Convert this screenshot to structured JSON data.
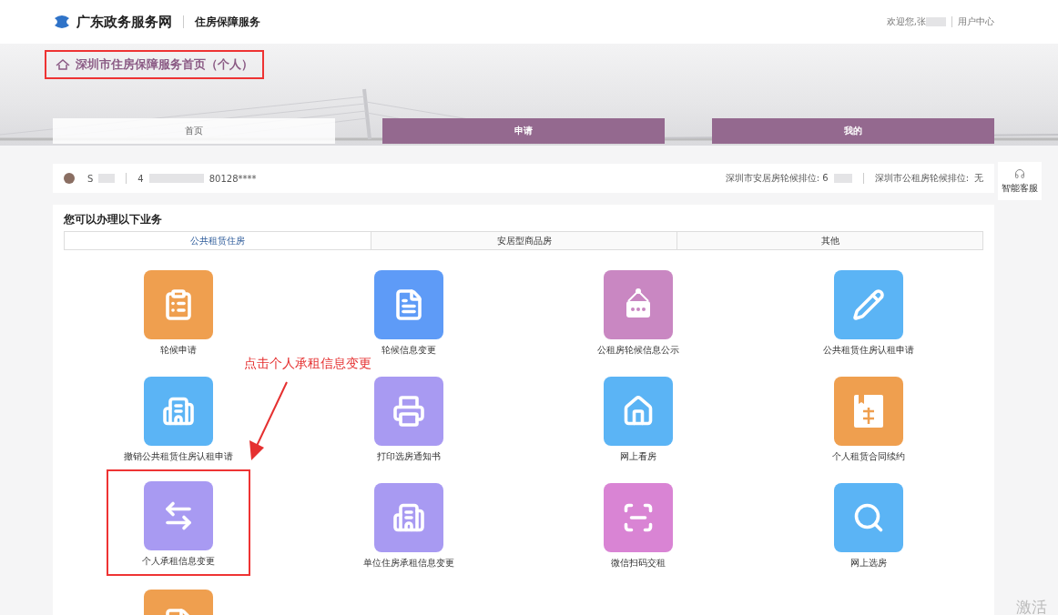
{
  "header": {
    "site_name": "广东政务服务网",
    "section": "住房保障服务",
    "welcome": "欢迎您,张",
    "user_center": "用户中心"
  },
  "banner": {
    "title": "深圳市住房保障服务首页（个人）",
    "highlighted": true
  },
  "nav_tabs": [
    {
      "label": "首页",
      "selected": true
    },
    {
      "label": "申请",
      "selected": false
    },
    {
      "label": "我的",
      "selected": false
    }
  ],
  "user_info": {
    "name": "S",
    "id_prefix": "4",
    "id_suffix": "80128****",
    "queue_1_label": "深圳市安居房轮候排位: 6",
    "queue_2_label": "深圳市公租房轮候排位: ",
    "queue_2_value": "无"
  },
  "assistant": {
    "label": "智能客服"
  },
  "services": {
    "title": "您可以办理以下业务",
    "tabs": [
      {
        "label": "公共租赁住房",
        "selected": true
      },
      {
        "label": "安居型商品房",
        "selected": false
      },
      {
        "label": "其他",
        "selected": false
      }
    ],
    "items": [
      {
        "label": "轮候申请",
        "color": "#ef9f4f",
        "highlighted": false
      },
      {
        "label": "轮候信息变更",
        "color": "#5e9bf7",
        "highlighted": false
      },
      {
        "label": "公租房轮候信息公示",
        "color": "#c987c2",
        "highlighted": false
      },
      {
        "label": "公共租赁住房认租申请",
        "color": "#5bb4f5",
        "highlighted": false
      },
      {
        "label": "撤销公共租赁住房认租申请",
        "color": "#5bb4f5",
        "highlighted": false
      },
      {
        "label": "打印选房通知书",
        "color": "#a89af2",
        "highlighted": false
      },
      {
        "label": "网上看房",
        "color": "#5bb4f5",
        "highlighted": false
      },
      {
        "label": "个人租赁合同续约",
        "color": "#ef9f4f",
        "highlighted": false
      },
      {
        "label": "个人承租信息变更",
        "color": "#a89af2",
        "highlighted": true
      },
      {
        "label": "单位住房承租信息变更",
        "color": "#a89af2",
        "highlighted": false
      },
      {
        "label": "微信扫码交租",
        "color": "#d984d4",
        "highlighted": false
      },
      {
        "label": "网上选房",
        "color": "#5bb4f5",
        "highlighted": false
      },
      {
        "color": "#ef9f4f",
        "highlighted": false
      }
    ]
  },
  "annotation": {
    "text": "点击个人承租信息变更"
  },
  "overlay_text": "激活"
}
